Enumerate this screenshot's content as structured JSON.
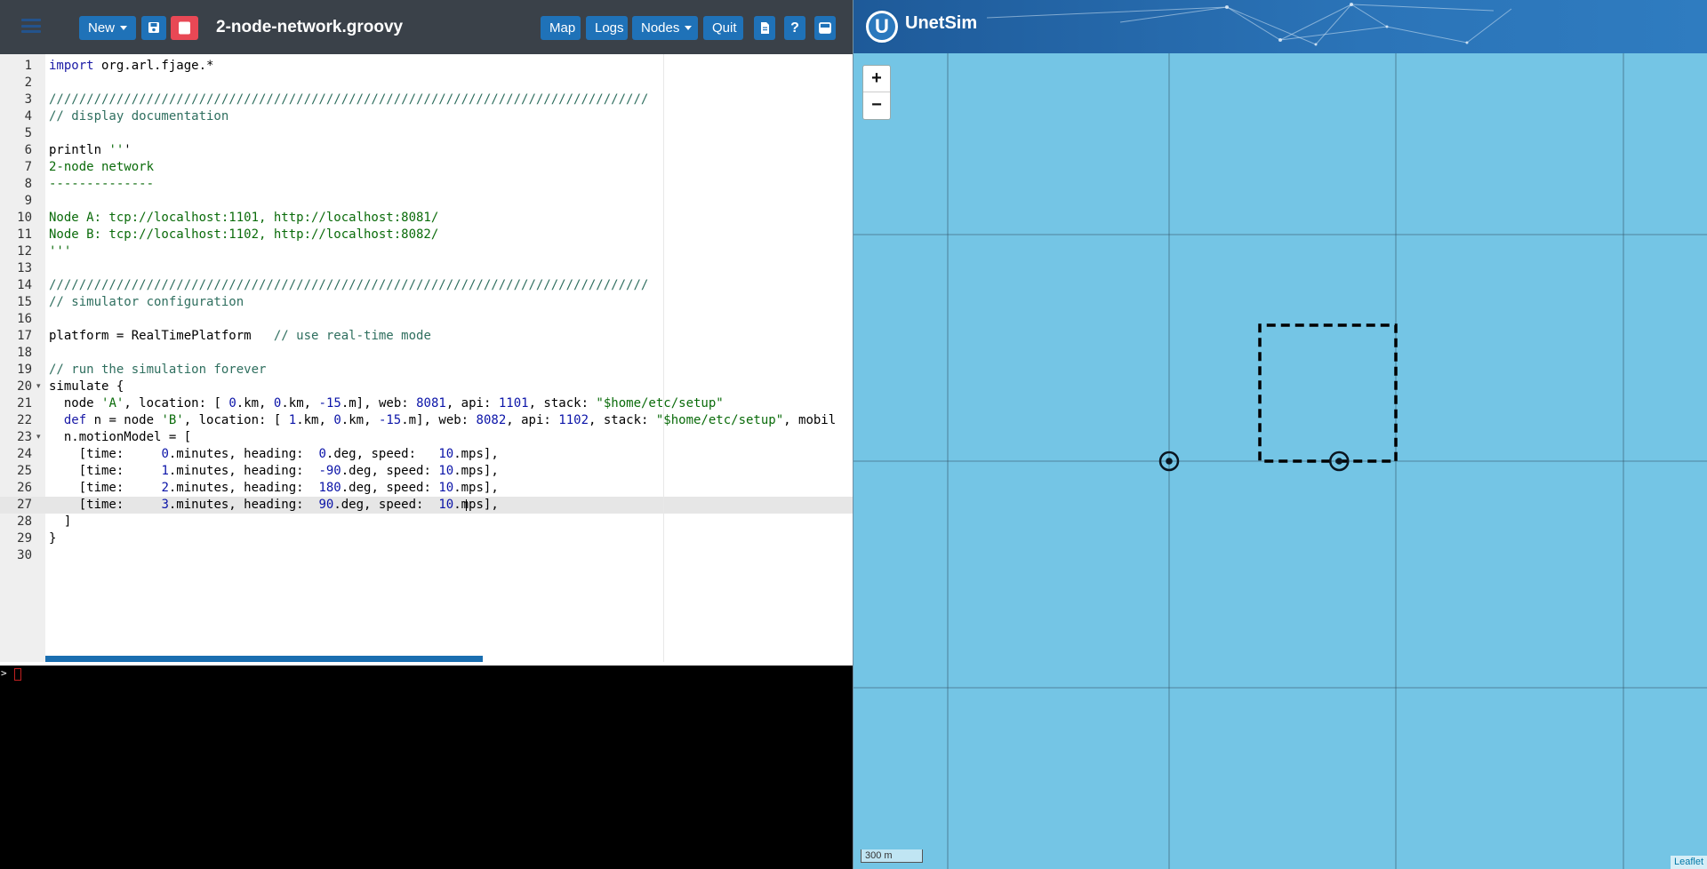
{
  "editor_toolbar": {
    "new_label": "New",
    "file_title": "2-node-network.groovy",
    "map_label": "Map",
    "logs_label": "Logs",
    "nodes_label": "Nodes",
    "quit_label": "Quit",
    "icons": [
      "menu-icon",
      "save-icon",
      "stop-icon",
      "document-icon",
      "help-icon",
      "panel-icon"
    ]
  },
  "editor": {
    "lines": [
      "import org.arl.fjage.*",
      "",
      "////////////////////////////////////////////////////////////////////////////////",
      "// display documentation",
      "",
      "println '''",
      "2-node network",
      "--------------",
      "",
      "Node A: tcp://localhost:1101, http://localhost:8081/",
      "Node B: tcp://localhost:1102, http://localhost:8082/",
      "'''",
      "",
      "////////////////////////////////////////////////////////////////////////////////",
      "// simulator configuration",
      "",
      "platform = RealTimePlatform   // use real-time mode",
      "",
      "// run the simulation forever",
      "simulate {",
      "  node 'A', location: [ 0.km, 0.km, -15.m], web: 8081, api: 1101, stack: \"$home/etc/setup\"",
      "  def n = node 'B', location: [ 1.km, 0.km, -15.m], web: 8082, api: 1102, stack: \"$home/etc/setup\", mobil",
      "  n.motionModel = [",
      "    [time:     0.minutes, heading:  0.deg, speed:   10.mps],",
      "    [time:     1.minutes, heading:  -90.deg, speed: 10.mps],",
      "    [time:     2.minutes, heading:  180.deg, speed: 10.mps],",
      "    [time:     3.minutes, heading:  90.deg, speed:  10.mps],",
      "  ]",
      "}",
      ""
    ],
    "active_line": 27
  },
  "console": {
    "prompt": ">"
  },
  "map": {
    "brand": "UnetSim",
    "zoom_in_label": "+",
    "zoom_out_label": "−",
    "scale_label": "300 m",
    "attribution": "Leaflet",
    "background_color": "#74c5e5",
    "nodes": [
      {
        "name": "A",
        "x_km": 0.0,
        "y_km": 0.0
      },
      {
        "name": "B",
        "x_km": 0.75,
        "y_km": 0.0
      }
    ],
    "trajectory_km": [
      [
        0.75,
        0.0
      ],
      [
        1.0,
        0.0
      ],
      [
        1.0,
        0.6
      ],
      [
        0.4,
        0.6
      ],
      [
        0.4,
        0.0
      ],
      [
        0.75,
        0.0
      ]
    ]
  }
}
